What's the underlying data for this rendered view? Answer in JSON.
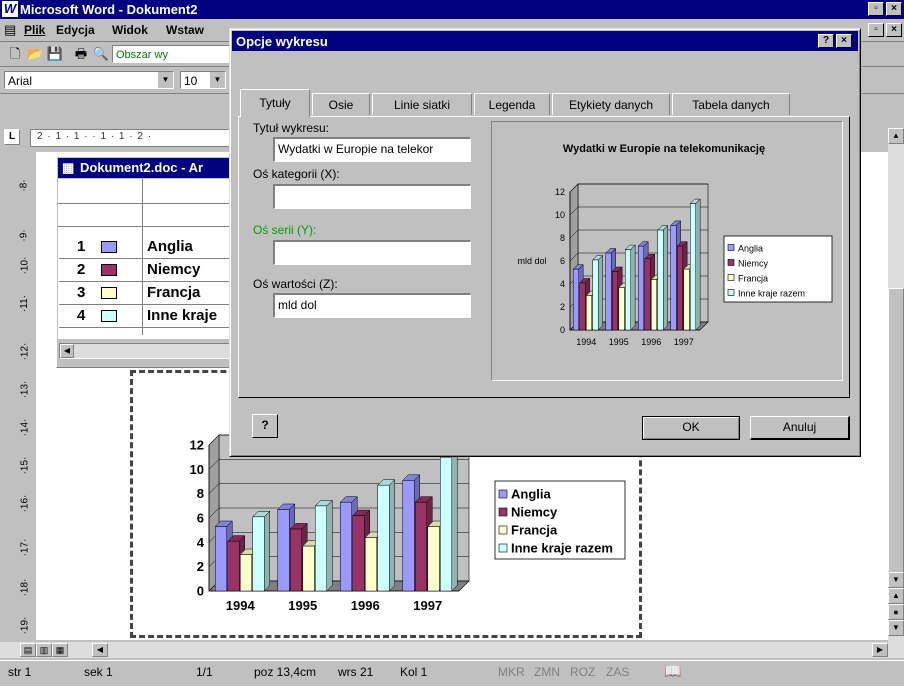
{
  "app": {
    "title": "Microsoft Word - Dokument2",
    "menu": [
      "Plik",
      "Edycja",
      "Widok",
      "Wstaw"
    ],
    "style_combo": "Obszar wy",
    "font_combo": "Arial",
    "size_combo": "10"
  },
  "datasheet": {
    "title": "Dokument2.doc - Ar",
    "rows": [
      {
        "num": "1",
        "label": "Anglia"
      },
      {
        "num": "2",
        "label": "Niemcy"
      },
      {
        "num": "3",
        "label": "Francja"
      },
      {
        "num": "4",
        "label": "Inne kraje"
      }
    ]
  },
  "ruler": {
    "horizontal": "2 · 1 · 1 ·  · 1 · 1 · 2 ·",
    "vertical": [
      "·8·",
      "·9·",
      "·10·",
      "·11·",
      "·12·",
      "·13·",
      "·14·",
      "·15·",
      "·16·",
      "·17·",
      "·18·",
      "·19·"
    ]
  },
  "dialog": {
    "title": "Opcje wykresu",
    "tabs": [
      "Tytuły",
      "Osie",
      "Linie siatki",
      "Legenda",
      "Etykiety danych",
      "Tabela danych"
    ],
    "fields": {
      "chart_title_label": "Tytuł wykresu:",
      "chart_title_value": "Wydatki w Europie na telekor",
      "category_axis_label": "Oś kategorii (X):",
      "category_axis_value": "",
      "series_axis_label": "Oś serii (Y):",
      "series_axis_value": "",
      "value_axis_label": "Oś wartości (Z):",
      "value_axis_value": "mld dol"
    },
    "ok_label": "OK",
    "cancel_label": "Anuluj",
    "help_icon": "help-icon"
  },
  "chart_data": [
    {
      "type": "bar",
      "title": "Wydatki w Europie na telekomunikację",
      "ylabel": "mld dol",
      "xlabel": "",
      "categories": [
        "1994",
        "1995",
        "1996",
        "1997"
      ],
      "ylim": [
        0,
        12
      ],
      "yticks": [
        "0",
        "2",
        "4",
        "6",
        "8",
        "10",
        "12"
      ],
      "legend_position": "right",
      "series": [
        {
          "name": "Anglia",
          "color": "#9999ff",
          "values": [
            5.3,
            6.7,
            7.3,
            9.1
          ]
        },
        {
          "name": "Niemcy",
          "color": "#993366",
          "values": [
            4.1,
            5.1,
            6.2,
            7.3
          ]
        },
        {
          "name": "Francja",
          "color": "#ffffcc",
          "values": [
            3.0,
            3.7,
            4.4,
            5.3
          ]
        },
        {
          "name": "Inne kraje razem",
          "color": "#ccffff",
          "values": [
            6.1,
            7.0,
            8.7,
            11.0
          ]
        }
      ]
    },
    {
      "type": "bar",
      "title": "",
      "ylabel": "",
      "xlabel": "",
      "categories": [
        "1994",
        "1995",
        "1996",
        "1997"
      ],
      "ylim": [
        0,
        12
      ],
      "yticks": [
        "0",
        "2",
        "4",
        "6",
        "8",
        "10",
        "12"
      ],
      "legend_position": "right",
      "series": [
        {
          "name": "Anglia",
          "color": "#9999ff",
          "values": [
            5.3,
            6.7,
            7.3,
            9.1
          ]
        },
        {
          "name": "Niemcy",
          "color": "#993366",
          "values": [
            4.1,
            5.1,
            6.2,
            7.3
          ]
        },
        {
          "name": "Francja",
          "color": "#ffffcc",
          "values": [
            3.0,
            3.7,
            4.4,
            5.3
          ]
        },
        {
          "name": "Inne kraje razem",
          "color": "#ccffff",
          "values": [
            6.1,
            7.0,
            8.7,
            11.0
          ]
        }
      ]
    }
  ],
  "status": {
    "page": "str 1",
    "section": "sek 1",
    "pages": "1/1",
    "position": "poz 13,4cm",
    "line": "wrs 21",
    "column": "Kol 1",
    "mkr": "MKR",
    "zmn": "ZMN",
    "roz": "ROZ",
    "zas": "ZAS"
  }
}
